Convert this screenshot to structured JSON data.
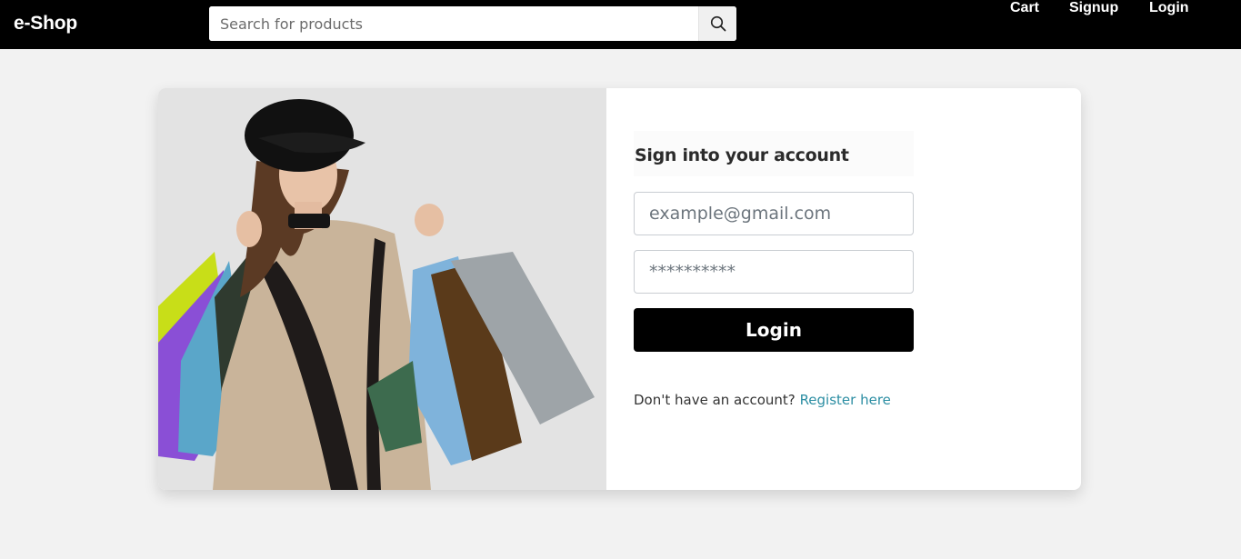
{
  "navbar": {
    "brand": "e-Shop",
    "search": {
      "placeholder": "Search for products",
      "value": "",
      "icon": "search-icon"
    },
    "links": {
      "cart": "Cart",
      "signup": "Signup",
      "login": "Login"
    }
  },
  "login_form": {
    "title": "Sign into your account",
    "email": {
      "placeholder": "example@gmail.com",
      "value": ""
    },
    "password": {
      "placeholder": "**********",
      "value": ""
    },
    "submit_label": "Login",
    "register_prompt": "Don't have an account?",
    "register_link": "Register here"
  },
  "colors": {
    "navbar_bg": "#000000",
    "page_bg": "#f2f2f2",
    "button_bg": "#000000",
    "link": "#2c8ea3"
  }
}
